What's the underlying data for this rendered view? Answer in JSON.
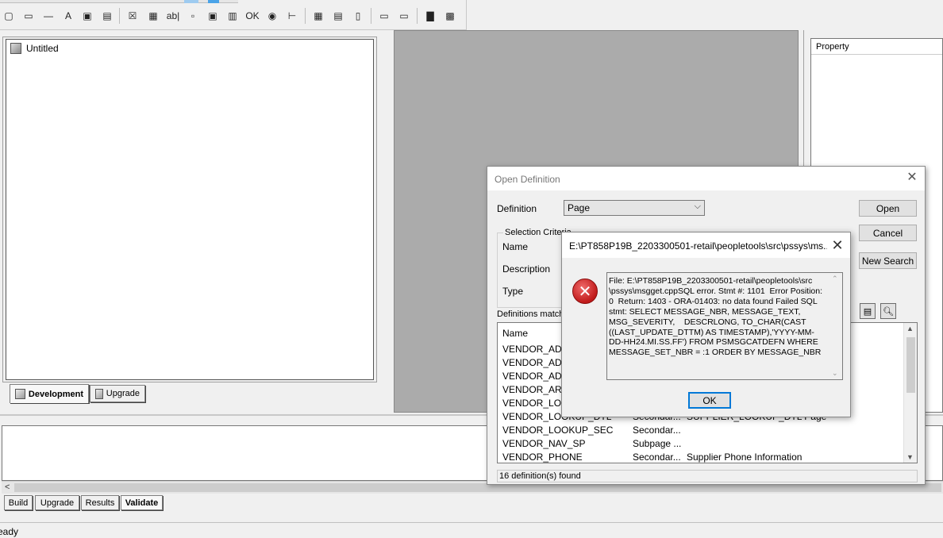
{
  "toolbar": {
    "buttons": [
      {
        "name": "frame-icon",
        "glyph": "▢"
      },
      {
        "name": "groupbox-icon",
        "glyph": "▭"
      },
      {
        "name": "horizontal-rule-icon",
        "glyph": "—"
      },
      {
        "name": "static-text-icon",
        "glyph": "A"
      },
      {
        "name": "static-image-icon",
        "glyph": "▣"
      },
      {
        "name": "chart-window-icon",
        "glyph": "▤"
      },
      {
        "name": "checkbox-icon",
        "glyph": "☒"
      },
      {
        "name": "dropdown-list-icon",
        "glyph": "▦"
      },
      {
        "name": "edit-box-icon",
        "glyph": "ab|"
      },
      {
        "name": "html-area-icon",
        "glyph": "▫"
      },
      {
        "name": "image-icon",
        "glyph": "▣"
      },
      {
        "name": "long-edit-box-icon",
        "glyph": "▥"
      },
      {
        "name": "push-button-icon",
        "glyph": "OK"
      },
      {
        "name": "radio-button-icon",
        "glyph": "◉"
      },
      {
        "name": "tree-icon",
        "glyph": "⊢"
      },
      {
        "name": "grid-icon",
        "glyph": "▦"
      },
      {
        "name": "scroll-area-icon",
        "glyph": "▤"
      },
      {
        "name": "scroll-bar-icon",
        "glyph": "▯"
      },
      {
        "name": "secondary-page-icon",
        "glyph": "▭"
      },
      {
        "name": "subpage-icon",
        "glyph": "▭"
      },
      {
        "name": "chart-icon",
        "glyph": "▇"
      },
      {
        "name": "analytic-grid-icon",
        "glyph": "▩"
      }
    ]
  },
  "left_pane": {
    "root_label": "Untitled",
    "tabs": {
      "development": "Development",
      "upgrade": "Upgrade"
    }
  },
  "right_pane": {
    "header": "Property"
  },
  "bottom_tabs": {
    "build": "Build",
    "upgrade": "Upgrade",
    "results": "Results",
    "validate": "Validate"
  },
  "status_bar": {
    "text": "eady"
  },
  "open_dialog": {
    "title": "Open Definition",
    "close_glyph": "✕",
    "definition_label": "Definition",
    "definition_value": "Page",
    "selection_criteria_label": "Selection Criteria",
    "name_label": "Name",
    "description_label": "Description",
    "type_label": "Type",
    "matching_label": "Definitions matchi",
    "buttons": {
      "open": "Open",
      "cancel": "Cancel",
      "new_search": "New Search"
    },
    "results_header": "Name",
    "rows": [
      {
        "name": "VENDOR_ADD",
        "type": "",
        "desc": ""
      },
      {
        "name": "VENDOR_ADD",
        "type": "",
        "desc": ""
      },
      {
        "name": "VENDOR_ADD",
        "type": "",
        "desc": ""
      },
      {
        "name": "VENDOR_AR",
        "type": "",
        "desc": ""
      },
      {
        "name": "VENDOR_LOO",
        "type": "",
        "desc": ""
      },
      {
        "name": "VENDOR_LOOKUP_DTL",
        "type": "Secondar...",
        "desc": "SUPPLIER_LOOKUP_DTL Page"
      },
      {
        "name": "VENDOR_LOOKUP_SEC",
        "type": "Secondar...",
        "desc": ""
      },
      {
        "name": "VENDOR_NAV_SP",
        "type": "Subpage ...",
        "desc": ""
      },
      {
        "name": "VENDOR_PHONE",
        "type": "Secondar...",
        "desc": "Supplier Phone Information"
      }
    ],
    "status": "16 definition(s) found"
  },
  "error_dialog": {
    "title": "E:\\PT858P19B_2203300501-retail\\peopletools\\src\\pssys\\ms...",
    "close_glyph": "✕",
    "message": "File: E:\\PT858P19B_2203300501-retail\\peopletools\\src\n\\pssys\\msgget.cppSQL error. Stmt #: 1101  Error Position:\n0  Return: 1403 - ORA-01403: no data found Failed SQL\nstmt: SELECT MESSAGE_NBR, MESSAGE_TEXT,\nMSG_SEVERITY,    DESCRLONG, TO_CHAR(CAST\n((LAST_UPDATE_DTTM) AS TIMESTAMP),'YYYY-MM-\nDD-HH24.MI.SS.FF') FROM PSMSGCATDEFN WHERE\nMESSAGE_SET_NBR = :1 ORDER BY MESSAGE_NBR",
    "ok_label": "OK"
  },
  "colors": {
    "center_pane": "#ababab",
    "error_red": "#c01a1a",
    "focus_blue": "#0078d7"
  }
}
